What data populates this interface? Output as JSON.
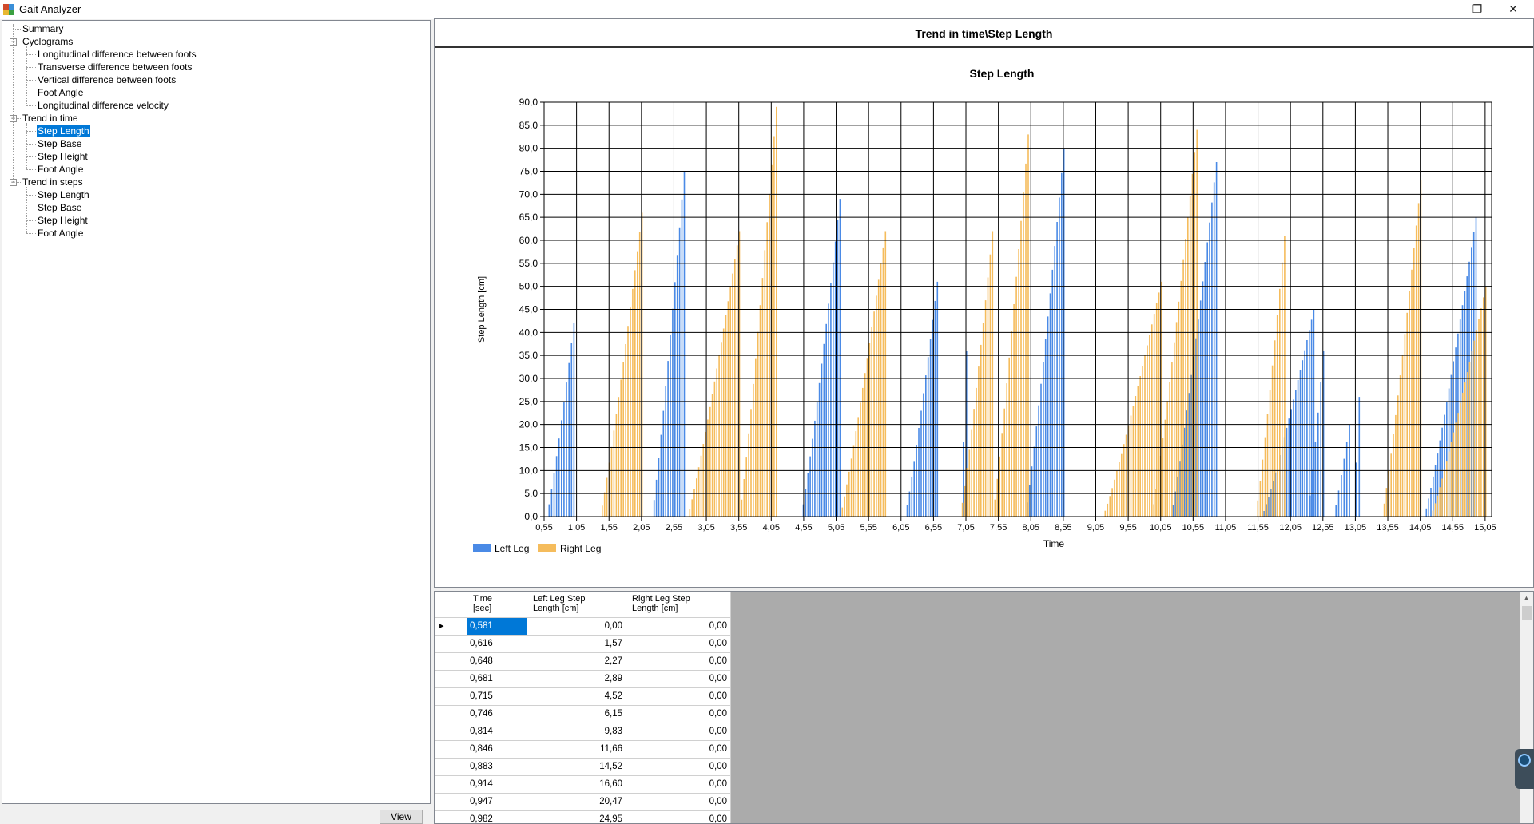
{
  "window": {
    "title": "Gait Analyzer",
    "minimize": "—",
    "maximize": "❐",
    "close": "✕"
  },
  "tree": [
    {
      "label": "Summary",
      "level": 0
    },
    {
      "label": "Cyclograms",
      "level": 0,
      "expander": "−"
    },
    {
      "label": "Longitudinal difference between foots",
      "level": 1
    },
    {
      "label": "Transverse difference between foots",
      "level": 1
    },
    {
      "label": "Vertical difference between foots",
      "level": 1
    },
    {
      "label": "Foot Angle",
      "level": 1
    },
    {
      "label": "Longitudinal difference velocity",
      "level": 1
    },
    {
      "label": "Trend in time",
      "level": 0,
      "expander": "−"
    },
    {
      "label": "Step Length",
      "level": 1,
      "selected": true
    },
    {
      "label": "Step Base",
      "level": 1
    },
    {
      "label": "Step Height",
      "level": 1
    },
    {
      "label": "Foot Angle",
      "level": 1
    },
    {
      "label": "Trend in steps",
      "level": 0,
      "expander": "−"
    },
    {
      "label": "Step Length",
      "level": 1
    },
    {
      "label": "Step Base",
      "level": 1
    },
    {
      "label": "Step Height",
      "level": 1
    },
    {
      "label": "Foot Angle",
      "level": 1
    }
  ],
  "view_button": "View",
  "panel_title": "Trend in time\\Step Length",
  "chart_data": {
    "type": "bar",
    "title": "Step Length",
    "xlabel": "Time",
    "ylabel": "Step Length [cm]",
    "ylim": [
      0,
      90
    ],
    "xlim": [
      0.55,
      15.15
    ],
    "yticks": [
      "0,0",
      "5,0",
      "10,0",
      "15,0",
      "20,0",
      "25,0",
      "30,0",
      "35,0",
      "40,0",
      "45,0",
      "50,0",
      "55,0",
      "60,0",
      "65,0",
      "70,0",
      "75,0",
      "80,0",
      "85,0",
      "90,0"
    ],
    "xticks": [
      "0,55",
      "1,05",
      "1,55",
      "2,05",
      "2,55",
      "3,05",
      "3,55",
      "4,05",
      "4,55",
      "5,05",
      "5,55",
      "6,05",
      "6,55",
      "7,05",
      "7,55",
      "8,05",
      "8,55",
      "9,05",
      "9,55",
      "10,05",
      "10,55",
      "11,05",
      "11,55",
      "12,05",
      "12,55",
      "13,05",
      "13,55",
      "14,05",
      "14,55",
      "15,05"
    ],
    "grid": true,
    "legend_position": "bottom-left",
    "series": [
      {
        "name": "Left Leg",
        "color": "#4a8ae6",
        "segments": [
          [
            0.58,
            1.0,
            0,
            42
          ],
          [
            2.2,
            2.7,
            0,
            75
          ],
          [
            4.5,
            5.1,
            0,
            69
          ],
          [
            6.1,
            6.6,
            0,
            51
          ],
          [
            6.95,
            7.05,
            0,
            36
          ],
          [
            7.95,
            8.55,
            0,
            80
          ],
          [
            10.2,
            10.9,
            0,
            77
          ],
          [
            11.6,
            12.4,
            0,
            45
          ],
          [
            12.3,
            12.55,
            0,
            36
          ],
          [
            12.7,
            12.95,
            0,
            20
          ],
          [
            13.0,
            13.1,
            0,
            26
          ],
          [
            14.1,
            14.9,
            0,
            65
          ]
        ]
      },
      {
        "name": "Right Leg",
        "color": "#f5bc5c",
        "segments": [
          [
            1.4,
            2.05,
            0,
            66
          ],
          [
            2.75,
            3.55,
            0,
            62
          ],
          [
            3.55,
            4.12,
            0,
            89
          ],
          [
            5.1,
            5.8,
            0,
            62
          ],
          [
            6.95,
            7.45,
            0,
            62
          ],
          [
            7.45,
            8.0,
            0,
            83
          ],
          [
            9.15,
            10.05,
            0,
            51
          ],
          [
            9.9,
            10.6,
            0,
            84
          ],
          [
            11.5,
            11.95,
            0,
            61
          ],
          [
            13.45,
            14.05,
            0,
            73
          ],
          [
            14.2,
            15.05,
            0,
            50
          ]
        ]
      }
    ]
  },
  "grid": {
    "headers": [
      "Time\n[sec]",
      "Left Leg Step\nLength [cm]",
      "Right Leg Step\nLength [cm]"
    ],
    "rows": [
      [
        "0,581",
        "0,00",
        "0,00"
      ],
      [
        "0,616",
        "1,57",
        "0,00"
      ],
      [
        "0,648",
        "2,27",
        "0,00"
      ],
      [
        "0,681",
        "2,89",
        "0,00"
      ],
      [
        "0,715",
        "4,52",
        "0,00"
      ],
      [
        "0,746",
        "6,15",
        "0,00"
      ],
      [
        "0,814",
        "9,83",
        "0,00"
      ],
      [
        "0,846",
        "11,66",
        "0,00"
      ],
      [
        "0,883",
        "14,52",
        "0,00"
      ],
      [
        "0,914",
        "16,60",
        "0,00"
      ],
      [
        "0,947",
        "20,47",
        "0,00"
      ],
      [
        "0,982",
        "24,95",
        "0,00"
      ]
    ],
    "current_row_marker": "▸"
  }
}
